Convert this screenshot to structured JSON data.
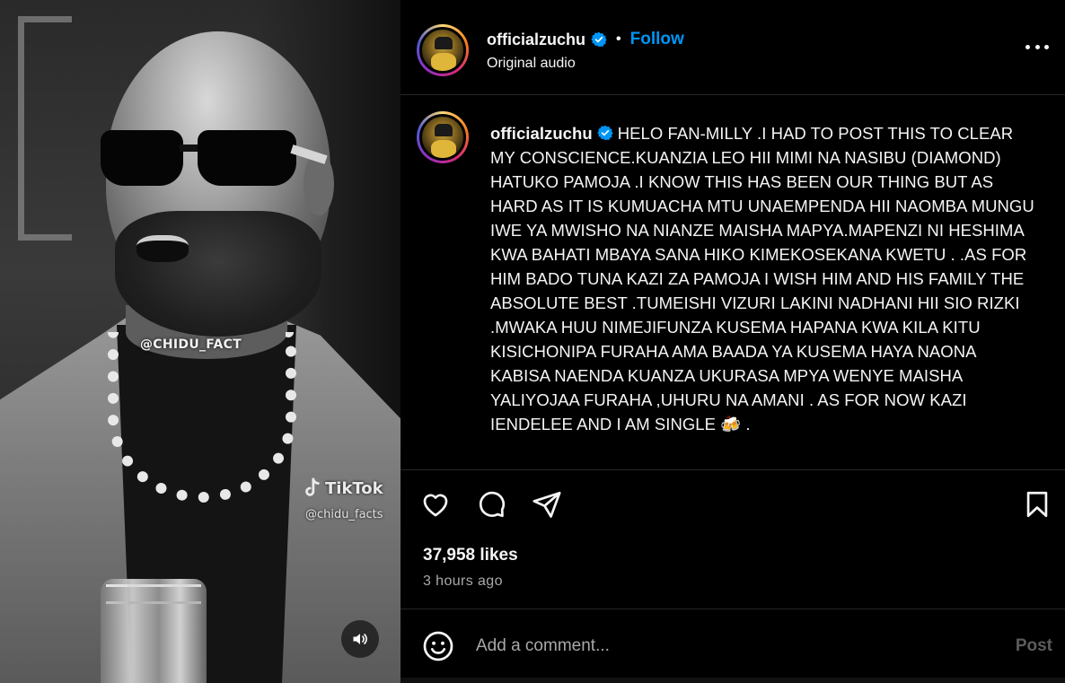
{
  "post": {
    "username": "officialzuchu",
    "verified": true,
    "follow_label": "Follow",
    "separator": "•",
    "audio_label": "Original audio",
    "caption": "HELO FAN-MILLY .I HAD TO POST THIS TO CLEAR MY CONSCIENCE.KUANZIA LEO HII MIMI NA NASIBU (DIAMOND) HATUKO PAMOJA .I KNOW THIS HAS BEEN OUR THING BUT AS HARD AS IT IS KUMUACHA MTU UNAEMPENDA HII NAOMBA MUNGU IWE YA MWISHO NA NIANZE MAISHA MAPYA.MAPENZI NI HESHIMA KWA BAHATI MBAYA SANA HIKO KIMEKOSEKANA KWETU . .AS FOR HIM BADO TUNA KAZI ZA PAMOJA I WISH HIM AND HIS FAMILY THE ABSOLUTE BEST .TUMEISHI VIZURI LAKINI NADHANI HII SIO RIZKI .MWAKA HUU NIMEJIFUNZA KUSEMA HAPANA KWA KILA KITU KISICHONIPA FURAHA AMA BAADA YA KUSEMA HAYA NAONA KABISA NAENDA KUANZA UKURASA MPYA WENYE MAISHA YALIYOJAA FURAHA ,UHURU NA AMANI . AS FOR NOW KAZI IENDELEE AND I AM SINGLE 🍻 .",
    "likes": "37,958 likes",
    "posted_ago": "3 hours ago"
  },
  "media": {
    "watermark_top": "@CHIDU_FACT",
    "watermark_brand": "TikTok",
    "watermark_handle": "@chidu_facts",
    "audio_icon": "speaker-icon"
  },
  "actions": {
    "like_icon": "heart-icon",
    "comment_icon": "comment-icon",
    "share_icon": "send-icon",
    "save_icon": "bookmark-icon"
  },
  "comment_box": {
    "placeholder": "Add a comment...",
    "post_label": "Post",
    "emoji_icon": "emoji-icon"
  },
  "colors": {
    "background": "#000000",
    "accent": "#0095f6",
    "verified": "#0095f6",
    "muted_text": "#a8a8a8"
  }
}
